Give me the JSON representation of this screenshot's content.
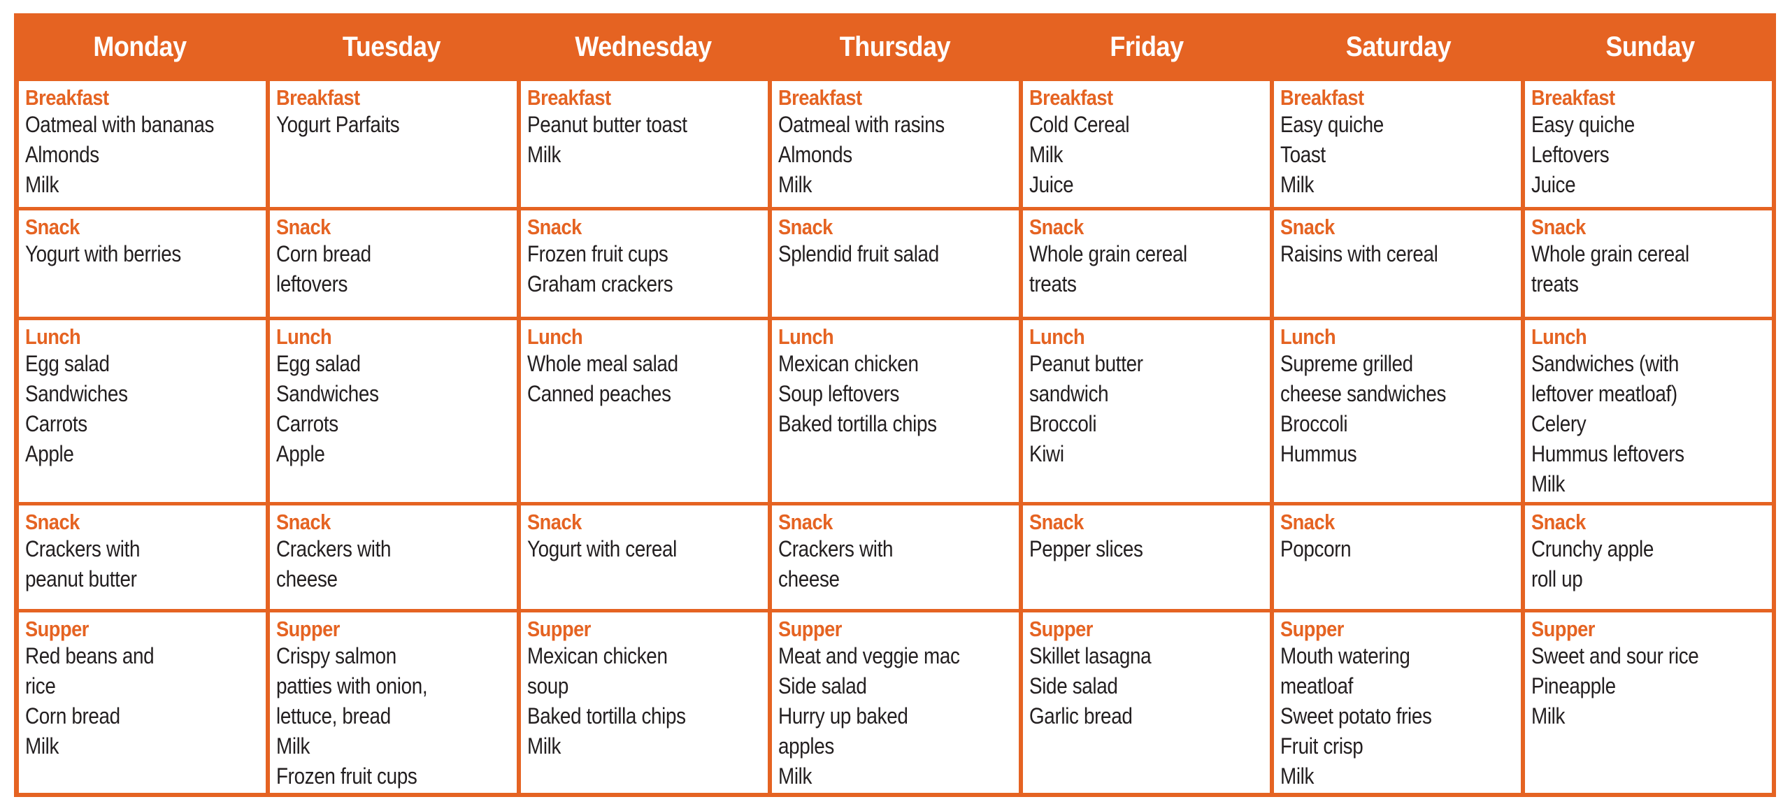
{
  "theme": {
    "accent": "#E56322",
    "text": "#231F20",
    "header_text": "#FFFFFF"
  },
  "days": [
    "Monday",
    "Tuesday",
    "Wednesday",
    "Thursday",
    "Friday",
    "Saturday",
    "Sunday"
  ],
  "meal_labels": [
    "Breakfast",
    "Snack",
    "Lunch",
    "Snack",
    "Supper"
  ],
  "meals": [
    [
      {
        "label": "Breakfast",
        "items": [
          "Oatmeal with bananas",
          "Almonds",
          "Milk"
        ]
      },
      {
        "label": "Breakfast",
        "items": [
          "Yogurt Parfaits"
        ]
      },
      {
        "label": "Breakfast",
        "items": [
          "Peanut butter toast",
          "Milk"
        ]
      },
      {
        "label": "Breakfast",
        "items": [
          "Oatmeal with rasins",
          "Almonds",
          "Milk"
        ]
      },
      {
        "label": "Breakfast",
        "items": [
          "Cold Cereal",
          "Milk",
          "Juice"
        ]
      },
      {
        "label": "Breakfast",
        "items": [
          "Easy quiche",
          "Toast",
          "Milk"
        ]
      },
      {
        "label": "Breakfast",
        "items": [
          "Easy quiche",
          "Leftovers",
          "Juice"
        ]
      }
    ],
    [
      {
        "label": "Snack",
        "items": [
          "Yogurt with berries"
        ]
      },
      {
        "label": "Snack",
        "items": [
          "Corn bread",
          "leftovers"
        ]
      },
      {
        "label": "Snack",
        "items": [
          "Frozen fruit cups",
          "Graham crackers"
        ]
      },
      {
        "label": "Snack",
        "items": [
          "Splendid fruit salad"
        ]
      },
      {
        "label": "Snack",
        "items": [
          "Whole grain cereal",
          "treats"
        ]
      },
      {
        "label": "Snack",
        "items": [
          "Raisins with cereal"
        ]
      },
      {
        "label": "Snack",
        "items": [
          "Whole grain cereal",
          "treats"
        ]
      }
    ],
    [
      {
        "label": "Lunch",
        "items": [
          "Egg salad",
          "Sandwiches",
          "Carrots",
          "Apple"
        ]
      },
      {
        "label": "Lunch",
        "items": [
          "Egg salad",
          "Sandwiches",
          "Carrots",
          "Apple"
        ]
      },
      {
        "label": "Lunch",
        "items": [
          "Whole meal salad",
          "Canned peaches"
        ]
      },
      {
        "label": "Lunch",
        "items": [
          "Mexican chicken",
          "Soup leftovers",
          "Baked tortilla chips"
        ]
      },
      {
        "label": "Lunch",
        "items": [
          "Peanut butter",
          "sandwich",
          "Broccoli",
          "Kiwi"
        ]
      },
      {
        "label": "Lunch",
        "items": [
          "Supreme grilled",
          "cheese sandwiches",
          "Broccoli",
          "Hummus"
        ]
      },
      {
        "label": "Lunch",
        "items": [
          "Sandwiches (with",
          "leftover meatloaf)",
          "Celery",
          "Hummus leftovers",
          "Milk"
        ]
      }
    ],
    [
      {
        "label": "Snack",
        "items": [
          "Crackers with",
          "peanut butter"
        ]
      },
      {
        "label": "Snack",
        "items": [
          "Crackers with",
          "cheese"
        ]
      },
      {
        "label": "Snack",
        "items": [
          "Yogurt with cereal"
        ]
      },
      {
        "label": "Snack",
        "items": [
          "Crackers with",
          "cheese"
        ]
      },
      {
        "label": "Snack",
        "items": [
          "Pepper slices"
        ]
      },
      {
        "label": "Snack",
        "items": [
          "Popcorn"
        ]
      },
      {
        "label": "Snack",
        "items": [
          "Crunchy apple",
          "roll up"
        ]
      }
    ],
    [
      {
        "label": "Supper",
        "items": [
          "Red beans and",
          "rice",
          "Corn bread",
          "Milk"
        ]
      },
      {
        "label": "Supper",
        "items": [
          "Crispy salmon",
          "patties with onion,",
          "lettuce, bread",
          "Milk",
          "Frozen fruit cups"
        ]
      },
      {
        "label": "Supper",
        "items": [
          "Mexican chicken",
          "soup",
          "Baked tortilla chips",
          "Milk"
        ]
      },
      {
        "label": "Supper",
        "items": [
          "Meat and veggie mac",
          "Side salad",
          "Hurry up baked",
          "apples",
          "Milk"
        ]
      },
      {
        "label": "Supper",
        "items": [
          "Skillet lasagna",
          "Side salad",
          "Garlic bread"
        ]
      },
      {
        "label": "Supper",
        "items": [
          "Mouth watering",
          "meatloaf",
          "Sweet potato fries",
          "Fruit crisp",
          "Milk"
        ]
      },
      {
        "label": "Supper",
        "items": [
          "Sweet and sour rice",
          "Pineapple",
          "Milk"
        ]
      }
    ]
  ]
}
